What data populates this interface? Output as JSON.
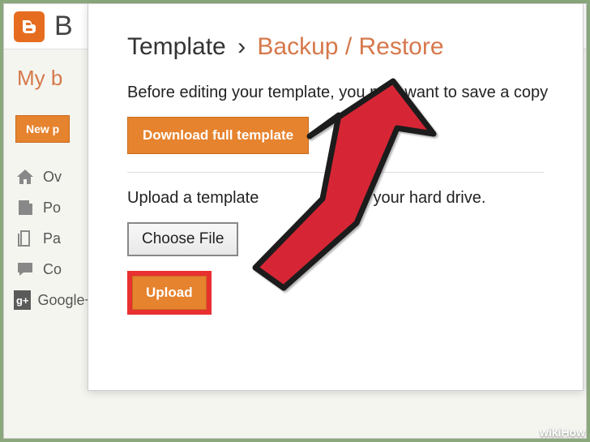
{
  "blogger_initial": "B",
  "my_blogs_label": "My b",
  "new_post_label": "New p",
  "nav": {
    "overview": "Ov",
    "posts": "Po",
    "pages": "Pa",
    "comments": "Co",
    "google_plus": "Google+"
  },
  "modal": {
    "breadcrumb_template": "Template",
    "breadcrumb_sep": "›",
    "breadcrumb_backup": "Backup / Restore",
    "text1": "Before editing your template, you may want to save a copy",
    "download_label": "Download full template",
    "text2_a": "Upload a template",
    "text2_b": "your hard drive.",
    "choose_file_label": "Choose File",
    "upload_label": "Upload"
  },
  "watermark": "wikiHow"
}
